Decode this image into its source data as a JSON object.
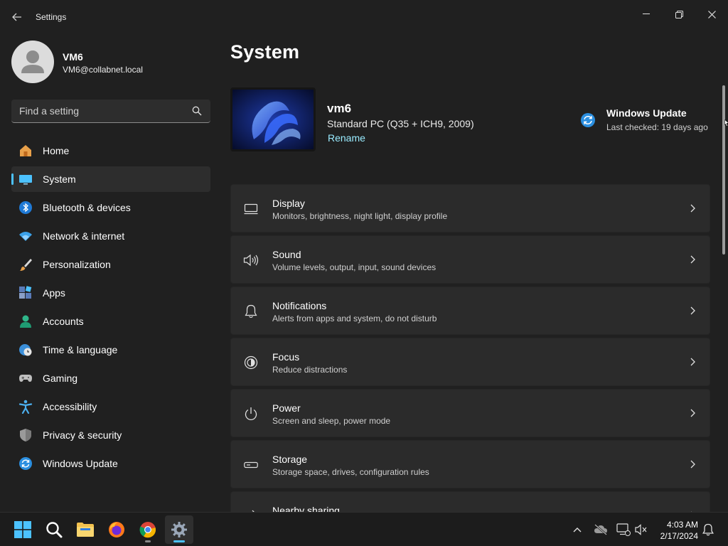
{
  "window": {
    "title": "Settings"
  },
  "user": {
    "name": "VM6",
    "email": "VM6@collabnet.local"
  },
  "search": {
    "placeholder": "Find a setting"
  },
  "sidebar": {
    "items": [
      {
        "label": "Home",
        "icon": "home-icon"
      },
      {
        "label": "System",
        "icon": "system-icon",
        "active": true
      },
      {
        "label": "Bluetooth & devices",
        "icon": "bluetooth-icon"
      },
      {
        "label": "Network & internet",
        "icon": "wifi-icon"
      },
      {
        "label": "Personalization",
        "icon": "brush-icon"
      },
      {
        "label": "Apps",
        "icon": "apps-icon"
      },
      {
        "label": "Accounts",
        "icon": "accounts-icon"
      },
      {
        "label": "Time & language",
        "icon": "clock-globe-icon"
      },
      {
        "label": "Gaming",
        "icon": "gamepad-icon"
      },
      {
        "label": "Accessibility",
        "icon": "accessibility-icon"
      },
      {
        "label": "Privacy & security",
        "icon": "shield-icon"
      },
      {
        "label": "Windows Update",
        "icon": "update-icon"
      }
    ]
  },
  "main": {
    "title": "System",
    "device": {
      "name": "vm6",
      "model": "Standard PC (Q35 + ICH9, 2009)",
      "rename_label": "Rename"
    },
    "windows_update": {
      "title": "Windows Update",
      "status": "Last checked: 19 days ago"
    },
    "cards": [
      {
        "title": "Display",
        "subtitle": "Monitors, brightness, night light, display profile",
        "icon": "monitor-icon"
      },
      {
        "title": "Sound",
        "subtitle": "Volume levels, output, input, sound devices",
        "icon": "speaker-icon"
      },
      {
        "title": "Notifications",
        "subtitle": "Alerts from apps and system, do not disturb",
        "icon": "bell-icon"
      },
      {
        "title": "Focus",
        "subtitle": "Reduce distractions",
        "icon": "focus-icon"
      },
      {
        "title": "Power",
        "subtitle": "Screen and sleep, power mode",
        "icon": "power-icon"
      },
      {
        "title": "Storage",
        "subtitle": "Storage space, drives, configuration rules",
        "icon": "storage-icon"
      },
      {
        "title": "Nearby sharing",
        "subtitle": "",
        "icon": "share-icon"
      }
    ]
  },
  "taskbar": {
    "time": "4:03 AM",
    "date": "2/17/2024"
  },
  "colors": {
    "accent": "#4cc2ff",
    "link": "#99ebff",
    "background": "#202020",
    "card": "#2b2b2b"
  }
}
